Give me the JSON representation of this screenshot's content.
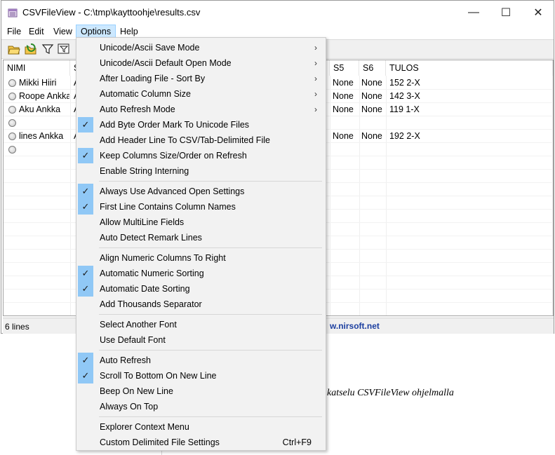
{
  "window": {
    "title": "CSVFileView  -  C:\\tmp\\kayttoohje\\results.csv",
    "minimize_glyph": "—",
    "maximize_glyph": "☐",
    "close_glyph": "✕"
  },
  "menubar": {
    "items": [
      "File",
      "Edit",
      "View",
      "Options",
      "Help"
    ],
    "active": "Options"
  },
  "toolbar": {
    "icons": [
      "open-folder-icon",
      "refresh-folder-icon",
      "filter-icon",
      "select-filter-icon"
    ]
  },
  "table": {
    "columns": [
      "NIMI",
      "S",
      "S5",
      "S6",
      "TULOS"
    ],
    "rows": [
      {
        "nimi": "Mikki Hiiri",
        "s": "A",
        "s5": "None",
        "s6": "None",
        "tulos": "152 2-X"
      },
      {
        "nimi": "Roope Ankka",
        "s": "A",
        "s5": "None",
        "s6": "None",
        "tulos": "142 3-X"
      },
      {
        "nimi": "Aku Ankka",
        "s": "A",
        "s5": "None",
        "s6": "None",
        "tulos": "119 1-X"
      },
      {
        "nimi": "",
        "s": "",
        "s5": "",
        "s6": "",
        "tulos": ""
      },
      {
        "nimi": "lines Ankka",
        "s": "A",
        "s5": "None",
        "s6": "None",
        "tulos": "192 2-X"
      },
      {
        "nimi": "",
        "s": "",
        "s5": "",
        "s6": "",
        "tulos": ""
      }
    ]
  },
  "statusbar": {
    "lines": "6 lines",
    "link": "w.nirsoft.net"
  },
  "background_doc": {
    "caption": "katselu CSVFileView ohjelmalla"
  },
  "options_menu": {
    "groups": [
      [
        {
          "label": "Unicode/Ascii Save Mode",
          "submenu": true,
          "checked": false
        },
        {
          "label": "Unicode/Ascii Default Open Mode",
          "submenu": true,
          "checked": false
        },
        {
          "label": "After Loading File - Sort By",
          "submenu": true,
          "checked": false
        },
        {
          "label": "Automatic Column Size",
          "submenu": true,
          "checked": false
        },
        {
          "label": "Auto Refresh Mode",
          "submenu": true,
          "checked": false
        },
        {
          "label": "Add Byte Order Mark To Unicode Files",
          "submenu": false,
          "checked": true
        },
        {
          "label": "Add Header Line To CSV/Tab-Delimited File",
          "submenu": false,
          "checked": false
        },
        {
          "label": "Keep Columns Size/Order on Refresh",
          "submenu": false,
          "checked": true
        },
        {
          "label": "Enable String Interning",
          "submenu": false,
          "checked": false
        }
      ],
      [
        {
          "label": "Always Use Advanced Open Settings",
          "submenu": false,
          "checked": true
        },
        {
          "label": "First Line Contains Column Names",
          "submenu": false,
          "checked": true
        },
        {
          "label": "Allow MultiLine Fields",
          "submenu": false,
          "checked": false
        },
        {
          "label": "Auto Detect Remark Lines",
          "submenu": false,
          "checked": false
        }
      ],
      [
        {
          "label": "Align Numeric Columns To Right",
          "submenu": false,
          "checked": false
        },
        {
          "label": "Automatic Numeric Sorting",
          "submenu": false,
          "checked": true
        },
        {
          "label": "Automatic Date Sorting",
          "submenu": false,
          "checked": true
        },
        {
          "label": "Add Thousands Separator",
          "submenu": false,
          "checked": false
        }
      ],
      [
        {
          "label": "Select Another Font",
          "submenu": false,
          "checked": false
        },
        {
          "label": "Use Default Font",
          "submenu": false,
          "checked": false
        }
      ],
      [
        {
          "label": "Auto Refresh",
          "submenu": false,
          "checked": true
        },
        {
          "label": "Scroll To Bottom On New Line",
          "submenu": false,
          "checked": true
        },
        {
          "label": "Beep On New Line",
          "submenu": false,
          "checked": false
        },
        {
          "label": "Always On Top",
          "submenu": false,
          "checked": false
        }
      ],
      [
        {
          "label": "Explorer Context Menu",
          "submenu": false,
          "checked": false
        },
        {
          "label": "Custom Delimited File Settings",
          "submenu": false,
          "checked": false,
          "shortcut": "Ctrl+F9"
        }
      ]
    ],
    "submenu_glyph": "›",
    "check_glyph": "✓"
  },
  "colors": {
    "menu_highlight": "#cce8ff",
    "check_bg": "#90c8f6",
    "link": "#1c3fa0"
  }
}
